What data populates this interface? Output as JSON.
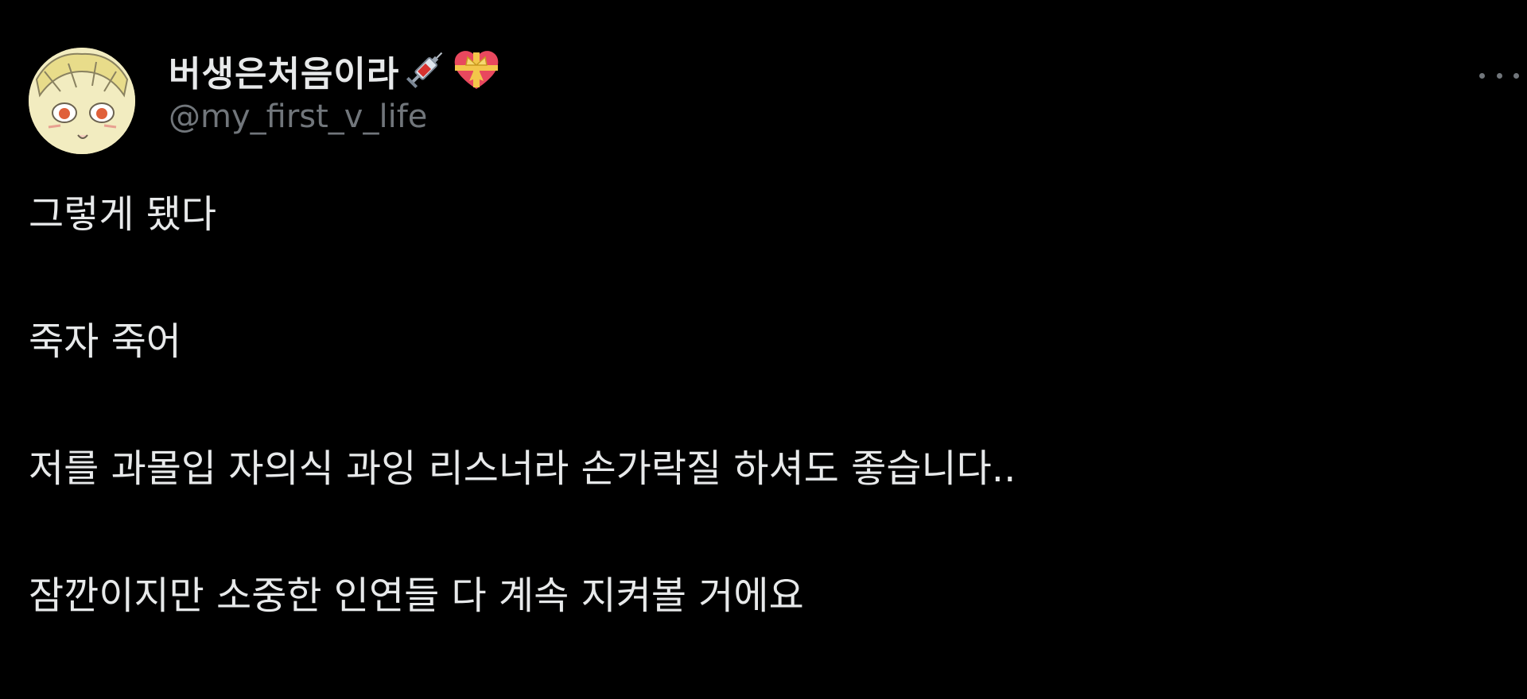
{
  "author": {
    "display_name": "버생은처음이라",
    "handle": "@my_first_v_life",
    "name_emojis": [
      "syringe-icon",
      "heart-with-ribbon-icon"
    ]
  },
  "tweet": {
    "paragraphs": [
      "그렇게 됐다",
      "죽자 죽어",
      "저를 과몰입 자의식 과잉 리스너라 손가락질 하셔도 좋습니다..",
      "잠깐이지만 소중한 인연들 다 계속 지켜볼 거에요"
    ]
  },
  "colors": {
    "background": "#000000",
    "primary_text": "#e7e9ea",
    "secondary_text": "#71767b"
  }
}
